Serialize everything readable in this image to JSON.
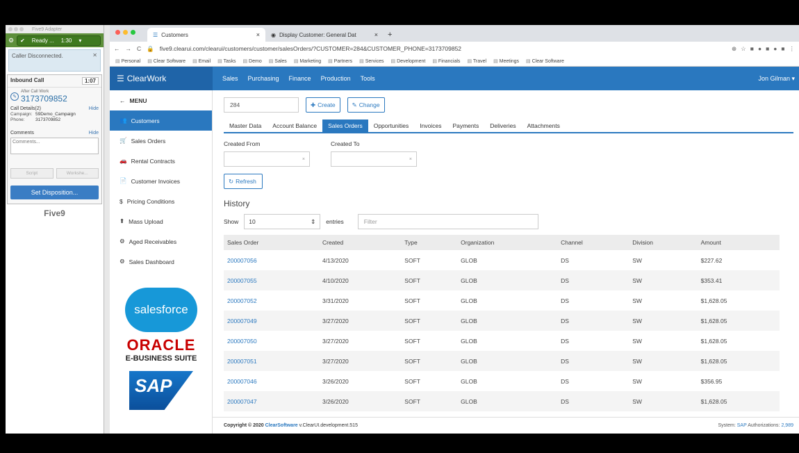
{
  "five9": {
    "title": "Five9 Adapter",
    "status": "Ready ...",
    "status_time": "1:30",
    "message": "Caller Disconnected.",
    "call_type": "Inbound Call",
    "call_time": "1:07",
    "acw_label": "After Call Work",
    "phone": "3173709852",
    "call_details": "Call Details(2)",
    "hide1": "Hide",
    "campaign_label": "Campaign:",
    "campaign": "59Demo_Campaign",
    "phone_label": "Phone:",
    "phone2": "3173709852",
    "comments_label": "Comments",
    "hide2": "Hide",
    "comments_placeholder": "Comments...",
    "script": "Script",
    "worksheet": "Workshe...",
    "set_disposition": "Set Disposition...",
    "logo": "Five9"
  },
  "browser": {
    "tab1": "Customers",
    "tab2": "Display Customer: General Dat",
    "url": "five9.clearui.com/clearui/customers/customer/salesOrders/?CUSTOMER=284&CUSTOMER_PHONE=3173709852",
    "bookmarks": [
      "Personal",
      "Clear Software",
      "Email",
      "Tasks",
      "Demo",
      "Sales",
      "Marketing",
      "Partners",
      "Services",
      "Development",
      "Financials",
      "Travel",
      "Meetings",
      "Clear Software"
    ]
  },
  "app": {
    "brand": "ClearWork",
    "nav": [
      "Sales",
      "Purchasing",
      "Finance",
      "Production",
      "Tools"
    ],
    "user": "Jon Gilman",
    "menu": "MENU",
    "side": [
      "Customers",
      "Sales Orders",
      "Rental Contracts",
      "Customer Invoices",
      "Pricing Conditions",
      "Mass Upload",
      "Aged Receivables",
      "Sales Dashboard"
    ],
    "logos": {
      "sf": "salesforce",
      "oracle": "ORACLE",
      "ebs": "E-BUSINESS SUITE",
      "sap": "SAP"
    }
  },
  "main": {
    "customer": "284",
    "create": "Create",
    "change": "Change",
    "tabs": [
      "Master Data",
      "Account Balance",
      "Sales Orders",
      "Opportunities",
      "Invoices",
      "Payments",
      "Deliveries",
      "Attachments"
    ],
    "created_from": "Created From",
    "created_to": "Created To",
    "refresh": "Refresh",
    "history": "History",
    "show": "Show",
    "show_val": "10",
    "entries": "entries",
    "filter": "Filter",
    "columns": [
      "Sales Order",
      "Created",
      "Type",
      "Organization",
      "Channel",
      "Division",
      "Amount"
    ],
    "rows": [
      [
        "200007056",
        "4/13/2020",
        "SOFT",
        "GLOB",
        "DS",
        "SW",
        "$227.62"
      ],
      [
        "200007055",
        "4/10/2020",
        "SOFT",
        "GLOB",
        "DS",
        "SW",
        "$353.41"
      ],
      [
        "200007052",
        "3/31/2020",
        "SOFT",
        "GLOB",
        "DS",
        "SW",
        "$1,628.05"
      ],
      [
        "200007049",
        "3/27/2020",
        "SOFT",
        "GLOB",
        "DS",
        "SW",
        "$1,628.05"
      ],
      [
        "200007050",
        "3/27/2020",
        "SOFT",
        "GLOB",
        "DS",
        "SW",
        "$1,628.05"
      ],
      [
        "200007051",
        "3/27/2020",
        "SOFT",
        "GLOB",
        "DS",
        "SW",
        "$1,628.05"
      ],
      [
        "200007046",
        "3/26/2020",
        "SOFT",
        "GLOB",
        "DS",
        "SW",
        "$356.95"
      ],
      [
        "200007047",
        "3/26/2020",
        "SOFT",
        "GLOB",
        "DS",
        "SW",
        "$1,628.05"
      ]
    ]
  },
  "footer": {
    "copyright": "Copyright © 2020",
    "company": "ClearSoftware",
    "version": "v.ClearUI.development.515",
    "system_label": "System:",
    "system": "SAP",
    "auth_label": "Authorizations:",
    "auth": "2,989"
  }
}
